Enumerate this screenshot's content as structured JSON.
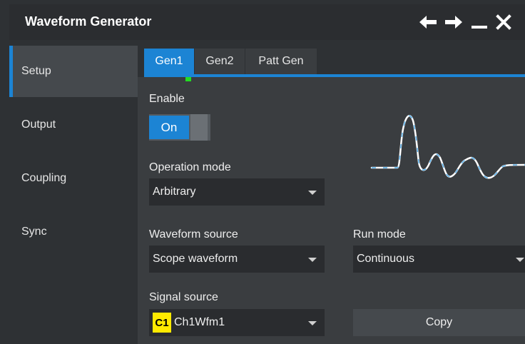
{
  "window": {
    "title": "Waveform Generator",
    "controls": {
      "back": "arrow-left-icon",
      "forward": "arrow-right-icon",
      "minimize": "minimize-icon",
      "close": "close-icon"
    }
  },
  "sidebar": {
    "items": [
      {
        "label": "Setup",
        "active": true
      },
      {
        "label": "Output",
        "active": false
      },
      {
        "label": "Coupling",
        "active": false
      },
      {
        "label": "Sync",
        "active": false
      }
    ]
  },
  "tabs": [
    {
      "label": "Gen1",
      "active": true,
      "indicator_color": "#22dd22"
    },
    {
      "label": "Gen2",
      "active": false
    },
    {
      "label": "Patt Gen",
      "active": false
    }
  ],
  "setup": {
    "enable_label": "Enable",
    "enable_value": "On",
    "operation_mode_label": "Operation mode",
    "operation_mode_value": "Arbitrary",
    "waveform_source_label": "Waveform source",
    "waveform_source_value": "Scope waveform",
    "run_mode_label": "Run mode",
    "run_mode_value": "Continuous",
    "signal_source_label": "Signal source",
    "signal_source_badge": "C1",
    "signal_source_value": "Ch1Wfm1",
    "copy_label": "Copy"
  },
  "preview": {
    "icon": "arbitrary-waveform-preview",
    "line_color": "#ffffff",
    "dash_color": "#4aa8e8"
  },
  "colors": {
    "accent": "#1c84d4",
    "channel1": "#ffea00",
    "background": "#3a3d40"
  }
}
